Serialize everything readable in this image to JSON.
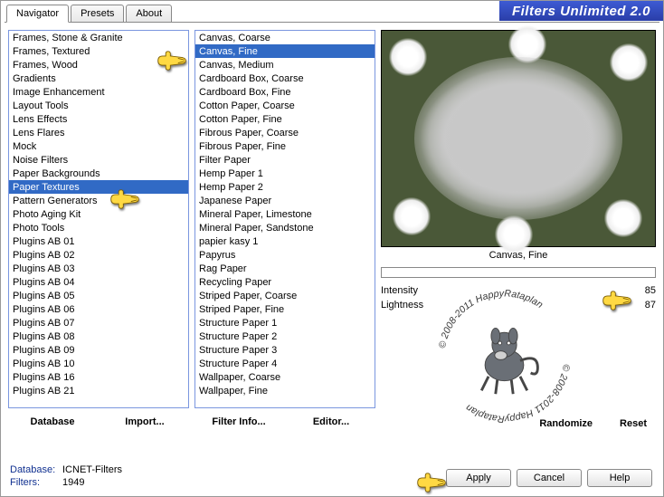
{
  "app_title": "Filters Unlimited 2.0",
  "tabs": [
    "Navigator",
    "Presets",
    "About"
  ],
  "categories": [
    "Frames, Stone & Granite",
    "Frames, Textured",
    "Frames, Wood",
    "Gradients",
    "Image Enhancement",
    "Layout Tools",
    "Lens Effects",
    "Lens Flares",
    "Mock",
    "Noise Filters",
    "Paper Backgrounds",
    "Paper Textures",
    "Pattern Generators",
    "Photo Aging Kit",
    "Photo Tools",
    "Plugins AB 01",
    "Plugins AB 02",
    "Plugins AB 03",
    "Plugins AB 04",
    "Plugins AB 05",
    "Plugins AB 06",
    "Plugins AB 07",
    "Plugins AB 08",
    "Plugins AB 09",
    "Plugins AB 10",
    "Plugins AB 16",
    "Plugins AB 21"
  ],
  "category_selected": "Paper Textures",
  "filters": [
    "Canvas, Coarse",
    "Canvas, Fine",
    "Canvas, Medium",
    "Cardboard Box, Coarse",
    "Cardboard Box, Fine",
    "Cotton Paper, Coarse",
    "Cotton Paper, Fine",
    "Fibrous Paper, Coarse",
    "Fibrous Paper, Fine",
    "Filter Paper",
    "Hemp Paper 1",
    "Hemp Paper 2",
    "Japanese Paper",
    "Mineral Paper, Limestone",
    "Mineral Paper, Sandstone",
    "papier kasy 1",
    "Papyrus",
    "Rag Paper",
    "Recycling Paper",
    "Striped Paper, Coarse",
    "Striped Paper, Fine",
    "Structure Paper 1",
    "Structure Paper 2",
    "Structure Paper 3",
    "Structure Paper 4",
    "Wallpaper, Coarse",
    "Wallpaper, Fine"
  ],
  "filter_selected": "Canvas, Fine",
  "left_buttons": [
    "Database",
    "Import..."
  ],
  "mid_buttons": [
    "Filter Info...",
    "Editor..."
  ],
  "right_buttons": [
    "Randomize",
    "Reset"
  ],
  "preview_label": "Canvas, Fine",
  "params": [
    {
      "label": "Intensity",
      "value": 85
    },
    {
      "label": "Lightness",
      "value": 87
    }
  ],
  "dlg_buttons": [
    "Apply",
    "Cancel",
    "Help"
  ],
  "status": {
    "db_label": "Database:",
    "db_value": "ICNET-Filters",
    "filters_label": "Filters:",
    "filters_value": "1949"
  },
  "watermark_text": "© 2008-2011 HappyRataplan"
}
